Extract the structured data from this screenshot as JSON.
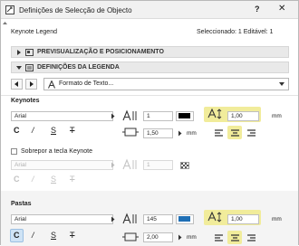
{
  "window": {
    "title": "Definições de Selecção de Objecto",
    "help_label": "?",
    "close_label": "✕"
  },
  "header": {
    "name": "Keynote Legend",
    "selection": "Seleccionado: 1 Editável: 1"
  },
  "sections": [
    {
      "label": "PREVISUALIZAÇÃO E POSICIONAMENTO",
      "expanded": false
    },
    {
      "label": "DEFINIÇÕES DA LEGENDA",
      "expanded": true
    }
  ],
  "nav": {
    "panel_select": "Formato de Texto..."
  },
  "keynotes": {
    "label": "Keynotes",
    "font": "Arial",
    "pen_number": "1",
    "text_height": "1,00",
    "text_height_unit": "mm",
    "width_factor": "1,50",
    "width_unit": "mm",
    "style_buttons": [
      "C",
      "/",
      "S",
      "T"
    ],
    "color": "#000000"
  },
  "override": {
    "label": "Sobrepor a tecla Keynote",
    "checked": false,
    "font": "Arial",
    "pen_number": "1",
    "style_buttons": [
      "C",
      "/",
      "S",
      "T"
    ]
  },
  "folders": {
    "label": "Pastas",
    "font": "Arial",
    "pen_number": "145",
    "text_height": "1,00",
    "text_height_unit": "mm",
    "width_factor": "2,00",
    "width_unit": "mm",
    "style_buttons": [
      "C",
      "/",
      "S",
      "T"
    ],
    "color": "#1f6fb5"
  }
}
